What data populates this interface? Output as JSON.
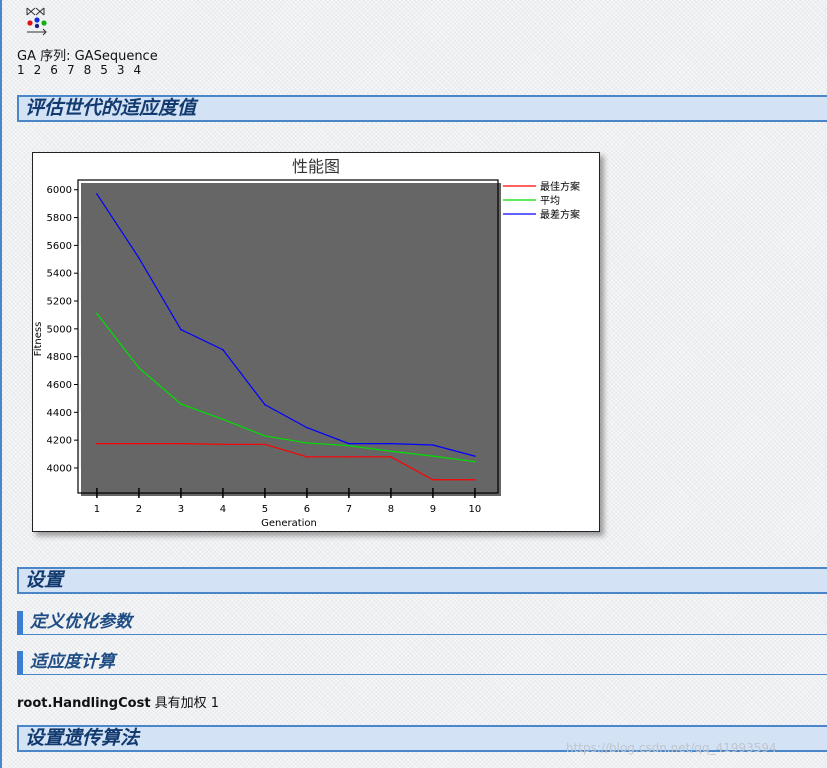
{
  "header": {
    "ga_label": "GA 序列: GASequence",
    "sequence": "1 2 6 7 8 5 3 4"
  },
  "sections": {
    "fitness_title": "评估世代的适应度值",
    "settings_title": "设置",
    "define_params_title": "定义优化参数",
    "fitness_calc_title": "适应度计算",
    "genetic_algo_title": "设置遗传算法"
  },
  "weight": {
    "name": "root.HandlingCost",
    "text": " 具有加权 1"
  },
  "watermark": "https://blog.csdn.net/qq_41993594",
  "chart_data": {
    "type": "line",
    "title": "性能图",
    "xlabel": "Generation",
    "ylabel": "Fitness",
    "x": [
      1,
      2,
      3,
      4,
      5,
      6,
      7,
      8,
      9,
      10
    ],
    "xlim": [
      0.55,
      10.55
    ],
    "ylim": [
      3820,
      6070
    ],
    "yticks": [
      4000,
      4200,
      4400,
      4600,
      4800,
      5000,
      5200,
      5400,
      5600,
      5800,
      6000
    ],
    "grid": "horizontal bands",
    "legend_position": "top-right outside",
    "series": [
      {
        "name": "最佳方案",
        "color": "#ff0000",
        "values": [
          4175,
          4175,
          4175,
          4170,
          4170,
          4080,
          4080,
          4080,
          3915,
          3915
        ]
      },
      {
        "name": "平均",
        "color": "#00e000",
        "values": [
          5110,
          4720,
          4460,
          4350,
          4230,
          4180,
          4160,
          4120,
          4085,
          4045
        ]
      },
      {
        "name": "最差方案",
        "color": "#0000ff",
        "values": [
          5970,
          5510,
          4995,
          4850,
          4455,
          4290,
          4175,
          4175,
          4165,
          4085
        ]
      }
    ]
  }
}
